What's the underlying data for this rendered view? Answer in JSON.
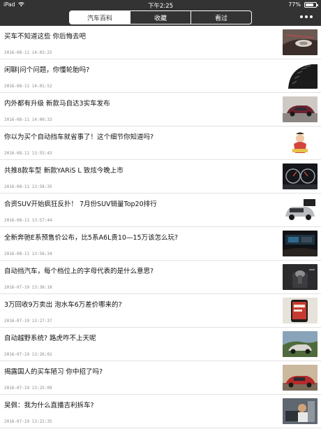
{
  "status_bar": {
    "carrier": "iPad",
    "time": "下午2:25",
    "battery_pct": "77%",
    "battery_level": 0.77
  },
  "tabs": [
    {
      "label": "汽车百科",
      "active": true
    },
    {
      "label": "收藏",
      "active": false
    },
    {
      "label": "看过",
      "active": false
    }
  ],
  "articles": [
    {
      "title": "买车不知道这些 你后悔去吧",
      "time": "2016-08-11 14:03:25",
      "thumb": "car-headlight-photo"
    },
    {
      "title": "闲聊|问个问题，你懂轮胎吗?",
      "time": "2016-08-11 14:01:52",
      "thumb": "tire-photo"
    },
    {
      "title": "内外都有升级 新款马自达3实车发布",
      "time": "2016-08-11 14:00:33",
      "thumb": "mazda3-photo"
    },
    {
      "title": "你以为买个自动挡车就省事了！这个细节你知道吗?",
      "time": "2016-08-11 13:55:43",
      "thumb": "cartoon-photo"
    },
    {
      "title": "共推8款车型 新款YARiS L 致炫今晚上市",
      "time": "2016-08-11 13:58:35",
      "thumb": "dashboard-photo"
    },
    {
      "title": "合资SUV开始疯狂反扑！ 7月份SUV销量Top20排行",
      "time": "2016-08-11 13:57:44",
      "thumb": "suv-photo"
    },
    {
      "title": "全新奔驰E系预售价公布，比5系A6L贵10—15万该怎么玩?",
      "time": "2016-08-11 13:56:34",
      "thumb": "interior-photo"
    },
    {
      "title": "自动挡汽车，每个档位上的字母代表的是什么意思?",
      "time": "2016-07-19 13:30:18",
      "thumb": "gear-shifter-photo"
    },
    {
      "title": "3万回收9万卖出 泡水车6万差价哪来的?",
      "time": "2016-07-19 13:27:37",
      "thumb": "phone-photo"
    },
    {
      "title": "自动越野系统? 路虎咋不上天呢",
      "time": "2016-07-19 13:26:02",
      "thumb": "offroad-photo"
    },
    {
      "title": "揭露国人的买车陋习 你中招了吗?",
      "time": "2016-07-19 13:25:09",
      "thumb": "red-car-photo"
    },
    {
      "title": "吴佩：我为什么直播吉利拆车?",
      "time": "2016-07-19 13:22:35",
      "thumb": "teardown-photo"
    }
  ],
  "colors": {
    "nav_bg": "#333333",
    "divider": "#e2e2e2",
    "time_text": "#8a8a8a"
  }
}
